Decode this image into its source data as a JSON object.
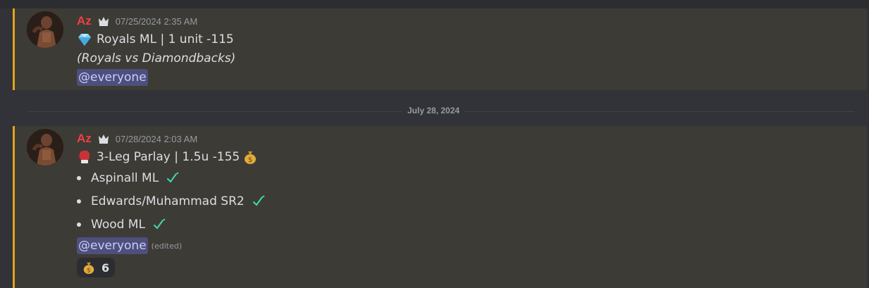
{
  "messages": [
    {
      "username": "Az",
      "timestamp": "07/25/2024 2:35 AM",
      "title_emoji": "gem-icon",
      "title": "Royals ML | 1 unit -115",
      "subtitle": "(Royals vs Diamondbacks)",
      "mention": "@everyone"
    },
    {
      "username": "Az",
      "timestamp": "07/28/2024 2:03 AM",
      "title_emoji": "boxing-glove-icon",
      "title": "3-Leg Parlay | 1.5u -155",
      "title_emoji_after": "money-bag-icon",
      "legs": [
        {
          "text": "Aspinall ML",
          "status": "check-icon"
        },
        {
          "text": "Edwards/Muhammad SR2",
          "status": "check-icon"
        },
        {
          "text": "Wood ML",
          "status": "check-icon"
        }
      ],
      "mention": "@everyone",
      "edited": "(edited)",
      "reaction": {
        "emoji": "money-bag-icon",
        "count": "6"
      }
    }
  ],
  "date_divider": "July 28, 2024",
  "colors": {
    "username": "#f23f43",
    "highlight_border": "#e0a41e",
    "highlight_bg": "#3d3b35",
    "mention_bg": "#4d4f7c",
    "check": "#3ddbb0"
  }
}
